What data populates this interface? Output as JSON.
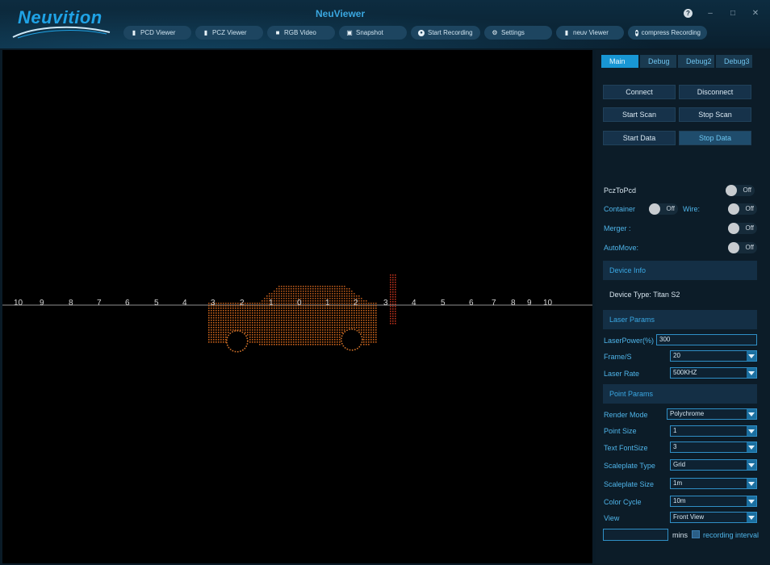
{
  "header": {
    "logo_text": "Neuvition",
    "app_title": "NeuViewer",
    "help_label": "?",
    "minimize_label": "–",
    "maximize_label": "□",
    "close_label": "✕"
  },
  "nav": [
    {
      "label": "PCD Viewer",
      "icon": "file-icon"
    },
    {
      "label": "PCZ Viewer",
      "icon": "file-icon"
    },
    {
      "label": "RGB Video",
      "icon": "video-camera-icon"
    },
    {
      "label": "Snapshot",
      "icon": "snapshot-icon"
    },
    {
      "label": "Start Recording",
      "icon": "record-icon"
    },
    {
      "label": "Settings",
      "icon": "gear-icon"
    },
    {
      "label": "neuv Viewer",
      "icon": "file-icon"
    },
    {
      "label": "compress Recording",
      "icon": "compress-icon"
    }
  ],
  "viewer": {
    "scale_labels": [
      "10",
      "9",
      "8",
      "7",
      "6",
      "5",
      "4",
      "3",
      "2",
      "1",
      "0",
      "1",
      "2",
      "3",
      "4",
      "5",
      "6",
      "7",
      "8",
      "9",
      "10"
    ],
    "point_color": "#c8621a"
  },
  "panel": {
    "tabs": [
      "Main",
      "Debug",
      "Debug2",
      "Debug3"
    ],
    "active_tab": "Main",
    "buttons": {
      "connect": "Connect",
      "disconnect": "Disconnect",
      "start_scan": "Start Scan",
      "stop_scan": "Stop Scan",
      "start_data": "Start Data",
      "stop_data": "Stop Data"
    },
    "toggles": {
      "pcz_to_pcd": {
        "label": "PczToPcd",
        "state": "Off"
      },
      "container": {
        "label": "Container",
        "state": "Off"
      },
      "wire": {
        "label": "Wire:",
        "state": "Off"
      },
      "merger": {
        "label": "Merger :",
        "state": "Off"
      },
      "automove": {
        "label": "AutoMove:",
        "state": "Off"
      }
    },
    "device_info": {
      "title": "Device Info",
      "device_type": "Device Type: Titan S2"
    },
    "laser_params": {
      "title": "Laser Params",
      "laser_power_label": "LaserPower(%)",
      "laser_power_value": "300",
      "frame_label": "Frame/S",
      "frame_value": "20",
      "laser_rate_label": "Laser Rate",
      "laser_rate_value": "500KHZ"
    },
    "point_params": {
      "title": "Point Params",
      "render_mode_label": "Render Mode",
      "render_mode_value": "Polychrome",
      "point_size_label": "Point Size",
      "point_size_value": "1",
      "text_fontsize_label": "Text FontSize",
      "text_fontsize_value": "3",
      "scaleplate_type_label": "Scaleplate Type",
      "scaleplate_type_value": "Grid",
      "scaleplate_size_label": "Scaleplate Size",
      "scaleplate_size_value": "1m",
      "color_cycle_label": "Color Cycle",
      "color_cycle_value": "10m",
      "view_label": "View",
      "view_value": "Front View"
    },
    "recording": {
      "interval_value": "",
      "mins_label": "mins",
      "interval_label": "recording interval"
    }
  },
  "colors": {
    "accent": "#1896d4",
    "header_bg": "#0b2536",
    "panel_bg": "#0c1c28"
  }
}
